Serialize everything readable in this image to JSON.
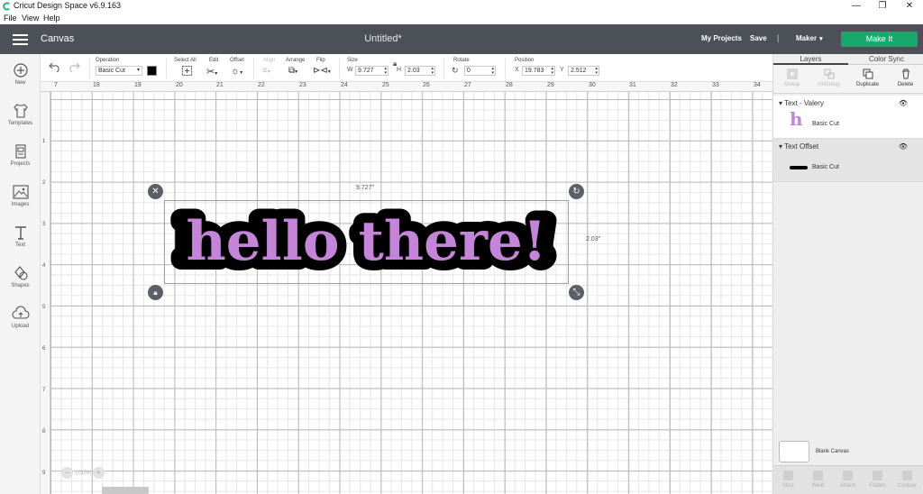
{
  "window": {
    "title": "Cricut Design Space  v6.9.163",
    "minimize": "—",
    "maximize": "❐",
    "close": "✕"
  },
  "menu": [
    "File",
    "View",
    "Help"
  ],
  "topnav": {
    "section": "Canvas",
    "doc_title": "Untitled*",
    "my_projects": "My Projects",
    "save": "Save",
    "separator": "|",
    "machine": "Maker",
    "make_it": "Make It",
    "accent_color": "#17a86b",
    "bar_color": "#4b5157"
  },
  "left_tools": [
    {
      "label": "New",
      "icon": "plus-circle-icon"
    },
    {
      "label": "Templates",
      "icon": "tshirt-icon"
    },
    {
      "label": "Projects",
      "icon": "projects-icon"
    },
    {
      "label": "Images",
      "icon": "image-icon"
    },
    {
      "label": "Text",
      "icon": "text-icon"
    },
    {
      "label": "Shapes",
      "icon": "shapes-icon"
    },
    {
      "label": "Upload",
      "icon": "cloud-upload-icon"
    }
  ],
  "toolbar": {
    "undo_icon": "undo-icon",
    "redo_icon": "redo-icon",
    "operation_label": "Operation",
    "operation_value": "Basic Cut",
    "operation_color": "#000000",
    "select_all_label": "Select All",
    "edit_label": "Edit",
    "offset_label": "Offset",
    "align_label": "Align",
    "arrange_label": "Arrange",
    "flip_label": "Flip",
    "size_label": "Size",
    "size_w_prefix": "W",
    "size_w": "9.727",
    "size_h_prefix": "H",
    "size_h": "2.03",
    "rotate_label": "Rotate",
    "rotate_value": "0",
    "position_label": "Position",
    "pos_x_prefix": "X",
    "pos_x": "19.783",
    "pos_y_prefix": "Y",
    "pos_y": "2.512"
  },
  "ruler": {
    "top": [
      "7",
      "18",
      "19",
      "20",
      "21",
      "22",
      "23",
      "24",
      "25",
      "26",
      "27",
      "28",
      "29",
      "30",
      "31",
      "32",
      "33",
      "34"
    ],
    "left": [
      "1",
      "2",
      "3",
      "4",
      "5",
      "6",
      "7",
      "8",
      "9"
    ]
  },
  "canvas": {
    "text": "hello there!",
    "text_color": "#c485d9",
    "offset_color": "#000000",
    "width_label": "9.727\"",
    "height_label": "2.03\"",
    "zoom": "100%"
  },
  "layers_panel": {
    "tab_layers": "Layers",
    "tab_color_sync": "Color Sync",
    "actions": [
      {
        "label": "Group",
        "enabled": false
      },
      {
        "label": "UnGroup",
        "enabled": false
      },
      {
        "label": "Duplicate",
        "enabled": true
      },
      {
        "label": "Delete",
        "enabled": true
      }
    ],
    "groups": [
      {
        "name": "Text - Valery",
        "item": "Basic Cut",
        "thumb_glyph": "h",
        "thumb_color": "#c485d9"
      },
      {
        "name": "Text Offset",
        "item": "Basic Cut",
        "thumb_color": "#000000"
      }
    ],
    "blank_canvas": "Blank Canvas",
    "bottom_actions": [
      "Slice",
      "Weld",
      "Attach",
      "Flatten",
      "Contour"
    ]
  }
}
